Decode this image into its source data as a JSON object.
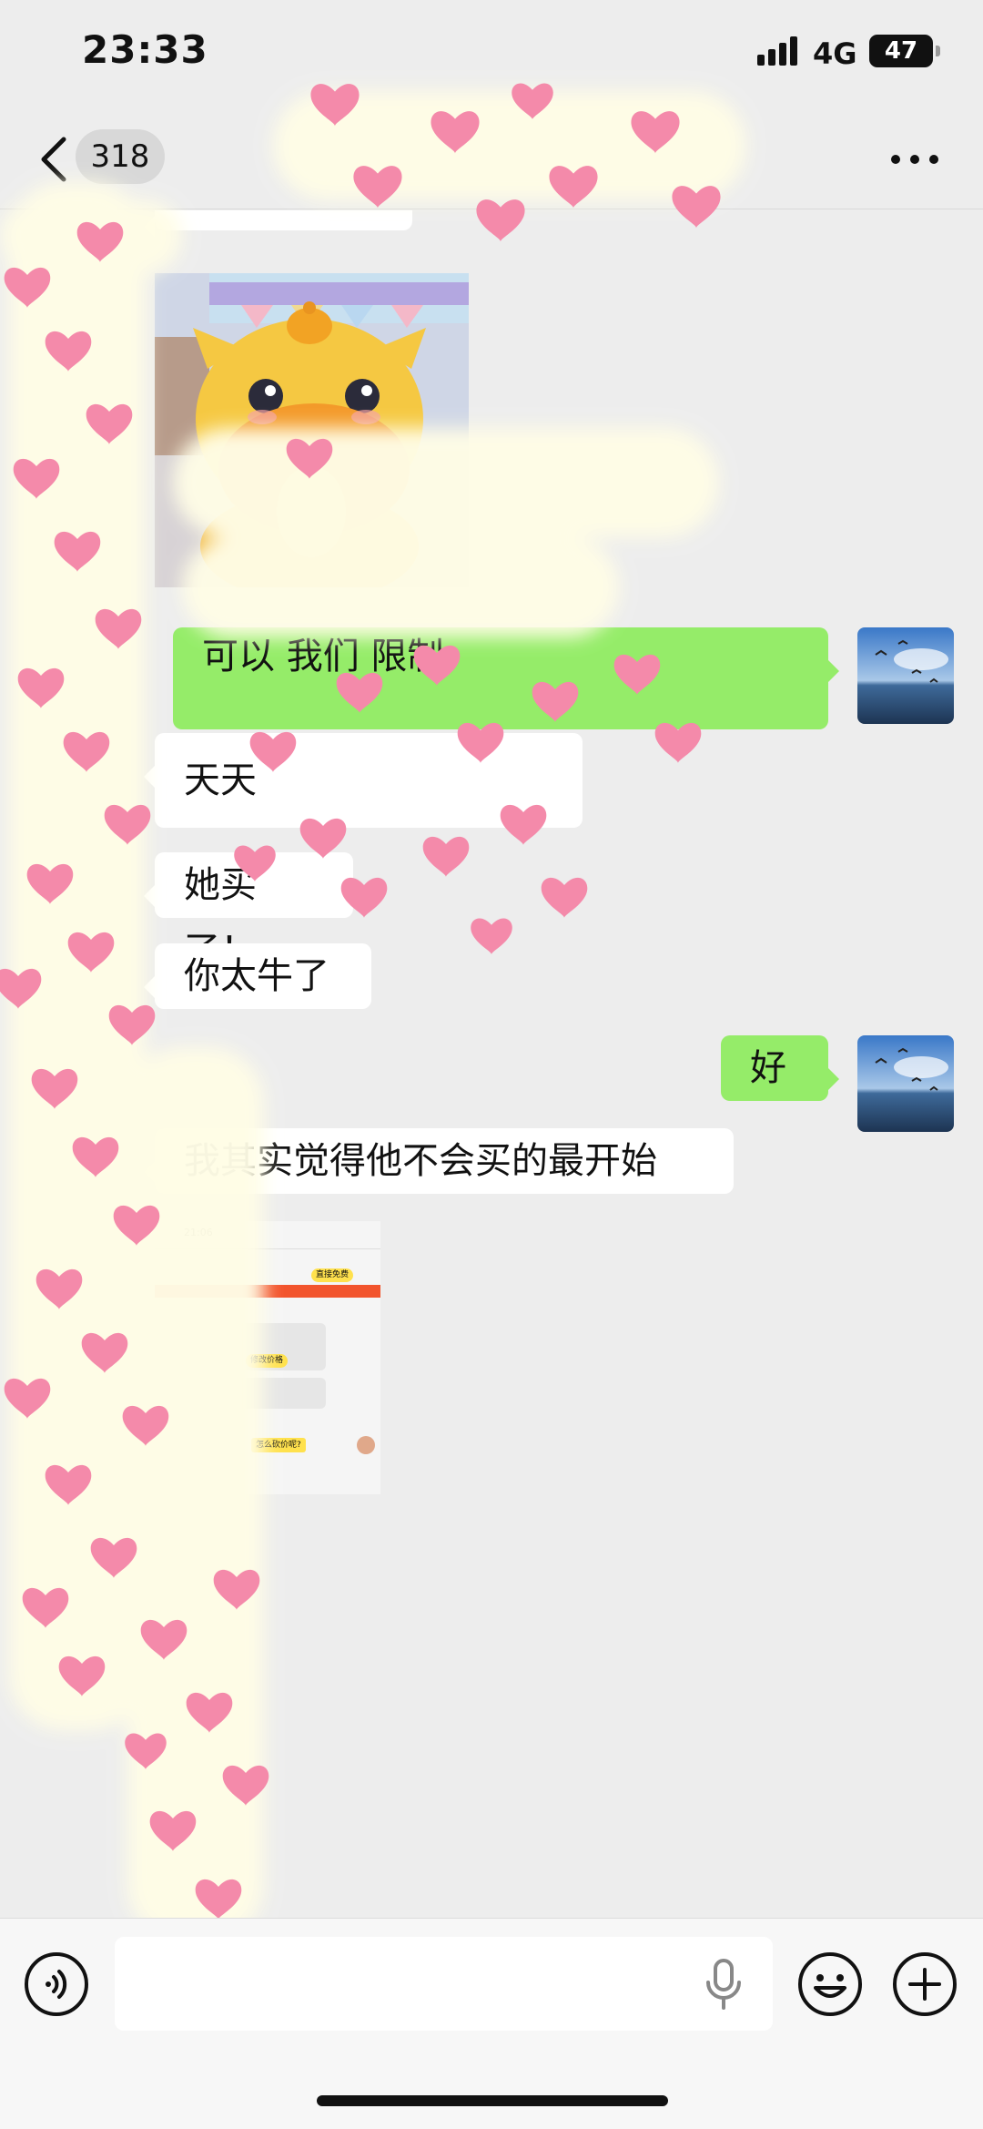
{
  "status_bar": {
    "time": "23:33",
    "network": "4G",
    "battery": "47"
  },
  "nav": {
    "unread_count": "318"
  },
  "messages": [
    {
      "from": "other",
      "type": "text",
      "text": ""
    },
    {
      "from": "other",
      "type": "image",
      "description": "sticker"
    },
    {
      "from": "me",
      "type": "text",
      "text": "可以 我们 限制"
    },
    {
      "from": "other",
      "type": "text",
      "text": "天天"
    },
    {
      "from": "other",
      "type": "text",
      "text": "她买了！"
    },
    {
      "from": "other",
      "type": "text",
      "text": "你太牛了"
    },
    {
      "from": "me",
      "type": "text",
      "text": "好"
    },
    {
      "from": "other",
      "type": "text",
      "text": "我其实觉得他不会买的最开始"
    },
    {
      "from": "other",
      "type": "image",
      "description": "screenshot",
      "inner": {
        "time": "21:06",
        "pill": "直接免费",
        "row": "修改价格",
        "ask": "怎么砍价呢?"
      }
    }
  ],
  "colors": {
    "background": "#ededed",
    "my_bubble": "#95ec69",
    "their_bubble": "#ffffff",
    "mask_heart": "#f48aaa",
    "mask_base": "#fffde6"
  },
  "icons": [
    "back-chevron-icon",
    "more-dots-icon",
    "voice-icon",
    "microphone-icon",
    "emoji-icon",
    "plus-icon"
  ]
}
